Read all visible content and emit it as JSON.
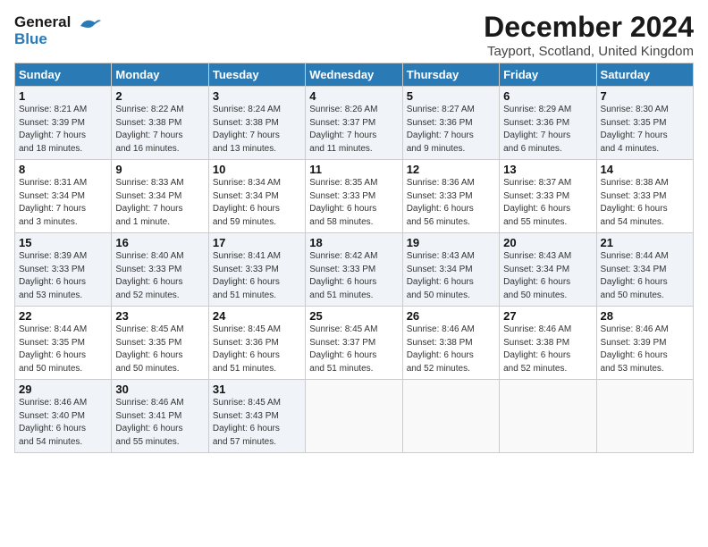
{
  "header": {
    "logo_line1": "General",
    "logo_line2": "Blue",
    "title": "December 2024",
    "subtitle": "Tayport, Scotland, United Kingdom"
  },
  "days_of_week": [
    "Sunday",
    "Monday",
    "Tuesday",
    "Wednesday",
    "Thursday",
    "Friday",
    "Saturday"
  ],
  "weeks": [
    [
      {
        "day": "1",
        "info": "Sunrise: 8:21 AM\nSunset: 3:39 PM\nDaylight: 7 hours\nand 18 minutes."
      },
      {
        "day": "2",
        "info": "Sunrise: 8:22 AM\nSunset: 3:38 PM\nDaylight: 7 hours\nand 16 minutes."
      },
      {
        "day": "3",
        "info": "Sunrise: 8:24 AM\nSunset: 3:38 PM\nDaylight: 7 hours\nand 13 minutes."
      },
      {
        "day": "4",
        "info": "Sunrise: 8:26 AM\nSunset: 3:37 PM\nDaylight: 7 hours\nand 11 minutes."
      },
      {
        "day": "5",
        "info": "Sunrise: 8:27 AM\nSunset: 3:36 PM\nDaylight: 7 hours\nand 9 minutes."
      },
      {
        "day": "6",
        "info": "Sunrise: 8:29 AM\nSunset: 3:36 PM\nDaylight: 7 hours\nand 6 minutes."
      },
      {
        "day": "7",
        "info": "Sunrise: 8:30 AM\nSunset: 3:35 PM\nDaylight: 7 hours\nand 4 minutes."
      }
    ],
    [
      {
        "day": "8",
        "info": "Sunrise: 8:31 AM\nSunset: 3:34 PM\nDaylight: 7 hours\nand 3 minutes."
      },
      {
        "day": "9",
        "info": "Sunrise: 8:33 AM\nSunset: 3:34 PM\nDaylight: 7 hours\nand 1 minute."
      },
      {
        "day": "10",
        "info": "Sunrise: 8:34 AM\nSunset: 3:34 PM\nDaylight: 6 hours\nand 59 minutes."
      },
      {
        "day": "11",
        "info": "Sunrise: 8:35 AM\nSunset: 3:33 PM\nDaylight: 6 hours\nand 58 minutes."
      },
      {
        "day": "12",
        "info": "Sunrise: 8:36 AM\nSunset: 3:33 PM\nDaylight: 6 hours\nand 56 minutes."
      },
      {
        "day": "13",
        "info": "Sunrise: 8:37 AM\nSunset: 3:33 PM\nDaylight: 6 hours\nand 55 minutes."
      },
      {
        "day": "14",
        "info": "Sunrise: 8:38 AM\nSunset: 3:33 PM\nDaylight: 6 hours\nand 54 minutes."
      }
    ],
    [
      {
        "day": "15",
        "info": "Sunrise: 8:39 AM\nSunset: 3:33 PM\nDaylight: 6 hours\nand 53 minutes."
      },
      {
        "day": "16",
        "info": "Sunrise: 8:40 AM\nSunset: 3:33 PM\nDaylight: 6 hours\nand 52 minutes."
      },
      {
        "day": "17",
        "info": "Sunrise: 8:41 AM\nSunset: 3:33 PM\nDaylight: 6 hours\nand 51 minutes."
      },
      {
        "day": "18",
        "info": "Sunrise: 8:42 AM\nSunset: 3:33 PM\nDaylight: 6 hours\nand 51 minutes."
      },
      {
        "day": "19",
        "info": "Sunrise: 8:43 AM\nSunset: 3:34 PM\nDaylight: 6 hours\nand 50 minutes."
      },
      {
        "day": "20",
        "info": "Sunrise: 8:43 AM\nSunset: 3:34 PM\nDaylight: 6 hours\nand 50 minutes."
      },
      {
        "day": "21",
        "info": "Sunrise: 8:44 AM\nSunset: 3:34 PM\nDaylight: 6 hours\nand 50 minutes."
      }
    ],
    [
      {
        "day": "22",
        "info": "Sunrise: 8:44 AM\nSunset: 3:35 PM\nDaylight: 6 hours\nand 50 minutes."
      },
      {
        "day": "23",
        "info": "Sunrise: 8:45 AM\nSunset: 3:35 PM\nDaylight: 6 hours\nand 50 minutes."
      },
      {
        "day": "24",
        "info": "Sunrise: 8:45 AM\nSunset: 3:36 PM\nDaylight: 6 hours\nand 51 minutes."
      },
      {
        "day": "25",
        "info": "Sunrise: 8:45 AM\nSunset: 3:37 PM\nDaylight: 6 hours\nand 51 minutes."
      },
      {
        "day": "26",
        "info": "Sunrise: 8:46 AM\nSunset: 3:38 PM\nDaylight: 6 hours\nand 52 minutes."
      },
      {
        "day": "27",
        "info": "Sunrise: 8:46 AM\nSunset: 3:38 PM\nDaylight: 6 hours\nand 52 minutes."
      },
      {
        "day": "28",
        "info": "Sunrise: 8:46 AM\nSunset: 3:39 PM\nDaylight: 6 hours\nand 53 minutes."
      }
    ],
    [
      {
        "day": "29",
        "info": "Sunrise: 8:46 AM\nSunset: 3:40 PM\nDaylight: 6 hours\nand 54 minutes."
      },
      {
        "day": "30",
        "info": "Sunrise: 8:46 AM\nSunset: 3:41 PM\nDaylight: 6 hours\nand 55 minutes."
      },
      {
        "day": "31",
        "info": "Sunrise: 8:45 AM\nSunset: 3:43 PM\nDaylight: 6 hours\nand 57 minutes."
      },
      {
        "day": "",
        "info": ""
      },
      {
        "day": "",
        "info": ""
      },
      {
        "day": "",
        "info": ""
      },
      {
        "day": "",
        "info": ""
      }
    ]
  ]
}
